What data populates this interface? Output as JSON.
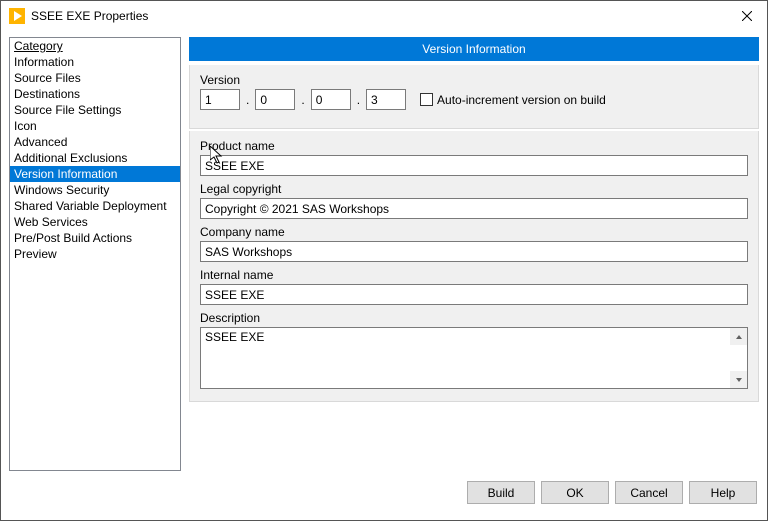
{
  "window": {
    "title": "SSEE EXE Properties"
  },
  "sidebar": {
    "header": "Category",
    "items": [
      {
        "label": "Information"
      },
      {
        "label": "Source Files"
      },
      {
        "label": "Destinations"
      },
      {
        "label": "Source File Settings"
      },
      {
        "label": "Icon"
      },
      {
        "label": "Advanced"
      },
      {
        "label": "Additional Exclusions"
      },
      {
        "label": "Version Information",
        "selected": true
      },
      {
        "label": "Windows Security"
      },
      {
        "label": "Shared Variable Deployment"
      },
      {
        "label": "Web Services"
      },
      {
        "label": "Pre/Post Build Actions"
      },
      {
        "label": "Preview"
      }
    ]
  },
  "main": {
    "section_title": "Version Information",
    "version_label": "Version",
    "version": {
      "major": "1",
      "minor": "0",
      "patch": "0",
      "build": "3"
    },
    "auto_increment_label": "Auto-increment version on build",
    "auto_increment_checked": false,
    "product_name_label": "Product name",
    "product_name": "SSEE EXE",
    "legal_copyright_label": "Legal copyright",
    "legal_copyright": "Copyright © 2021 SAS Workshops",
    "company_name_label": "Company name",
    "company_name": "SAS Workshops",
    "internal_name_label": "Internal name",
    "internal_name": "SSEE EXE",
    "description_label": "Description",
    "description": "SSEE EXE"
  },
  "buttons": {
    "build": "Build",
    "ok": "OK",
    "cancel": "Cancel",
    "help": "Help"
  }
}
